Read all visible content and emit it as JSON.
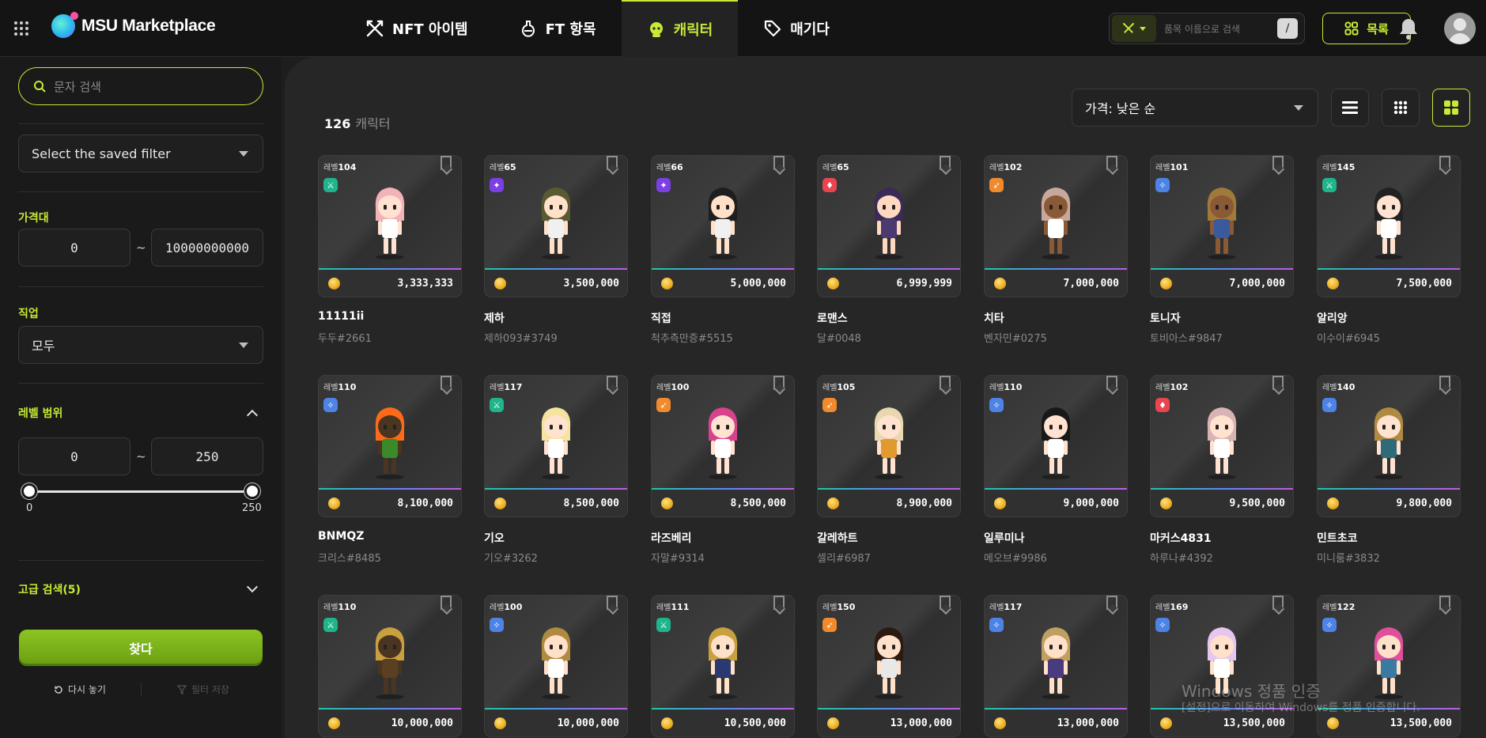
{
  "header": {
    "logo_text": "MSU Marketplace",
    "nav": [
      {
        "label": "NFT 아이템",
        "icon": "crossed-swords-icon"
      },
      {
        "label": "FT 항목",
        "icon": "potion-icon"
      },
      {
        "label": "캐릭터",
        "icon": "character-face-icon",
        "active": true
      },
      {
        "label": "매기다",
        "icon": "tag-icon"
      }
    ],
    "search_placeholder": "품목 이름으로 검색",
    "list_button": "목록"
  },
  "sidebar": {
    "search_placeholder": "문자 검색",
    "saved_filter": "Select the saved filter",
    "price_label": "가격대",
    "price_min": "0",
    "price_max": "10000000000",
    "job_label": "직업",
    "job_value": "모두",
    "level_label": "레벨 범위",
    "level_min": "0",
    "level_max": "250",
    "slider_min_label": "0",
    "slider_max_label": "250",
    "slider_low": 0,
    "slider_high": 250,
    "advanced_label": "고급 검색(5)",
    "find_button": "찾다",
    "reset_label": "다시 놓기",
    "save_filter_label": "필터 저장"
  },
  "main": {
    "count_number": "126",
    "count_label": "캐릭터",
    "sort_value": "가격: 낮은 순"
  },
  "colors": {
    "accent": "#c6ea35"
  },
  "level_prefix": "레벨",
  "cards": [
    {
      "level": "104",
      "job_color": "#1fb58c",
      "job_icon": "sword-icon",
      "price": "3,333,333",
      "name": "11111ii",
      "id": "두두#2661"
    },
    {
      "level": "65",
      "job_color": "#7b3fe4",
      "job_icon": "sparkle-icon",
      "price": "3,500,000",
      "name": "제하",
      "id": "제하093#3749"
    },
    {
      "level": "66",
      "job_color": "#7b3fe4",
      "job_icon": "sparkle-icon",
      "price": "5,000,000",
      "name": "직접",
      "id": "척추측만증#5515"
    },
    {
      "level": "65",
      "job_color": "#e8454f",
      "job_icon": "flame-icon",
      "price": "6,999,999",
      "name": "로맨스",
      "id": "달#0048"
    },
    {
      "level": "102",
      "job_color": "#f08a2c",
      "job_icon": "bow-icon",
      "price": "7,000,000",
      "name": "치타",
      "id": "벤자민#0275"
    },
    {
      "level": "101",
      "job_color": "#4d83e6",
      "job_icon": "wand-icon",
      "price": "7,000,000",
      "name": "토니자",
      "id": "토비아스#9847"
    },
    {
      "level": "145",
      "job_color": "#1fb58c",
      "job_icon": "sword-icon",
      "price": "7,500,000",
      "name": "알리앙",
      "id": "이수이#6945"
    },
    {
      "level": "110",
      "job_color": "#4d83e6",
      "job_icon": "wand-icon",
      "price": "8,100,000",
      "name": "BNMQZ",
      "id": "크리스#8485"
    },
    {
      "level": "117",
      "job_color": "#1fb58c",
      "job_icon": "sword-icon",
      "price": "8,500,000",
      "name": "기오",
      "id": "기오#3262"
    },
    {
      "level": "100",
      "job_color": "#f08a2c",
      "job_icon": "bow-icon",
      "price": "8,500,000",
      "name": "라즈베리",
      "id": "자말#9314"
    },
    {
      "level": "105",
      "job_color": "#f08a2c",
      "job_icon": "bow-icon",
      "price": "8,900,000",
      "name": "갈레하트",
      "id": "셀리#6987"
    },
    {
      "level": "110",
      "job_color": "#4d83e6",
      "job_icon": "wand-icon",
      "price": "9,000,000",
      "name": "일루미나",
      "id": "메오브#9986"
    },
    {
      "level": "102",
      "job_color": "#e8454f",
      "job_icon": "flame-icon",
      "price": "9,500,000",
      "name": "마커스4831",
      "id": "하루나#4392"
    },
    {
      "level": "140",
      "job_color": "#4d83e6",
      "job_icon": "wand-icon",
      "price": "9,800,000",
      "name": "민트초코",
      "id": "미니룸#3832"
    },
    {
      "level": "110",
      "job_color": "#1fb58c",
      "job_icon": "sword-icon",
      "price": "10,000,000",
      "name": "",
      "id": ""
    },
    {
      "level": "100",
      "job_color": "#4d83e6",
      "job_icon": "wand-icon",
      "price": "10,000,000",
      "name": "",
      "id": ""
    },
    {
      "level": "111",
      "job_color": "#1fb58c",
      "job_icon": "sword-icon",
      "price": "10,500,000",
      "name": "",
      "id": ""
    },
    {
      "level": "150",
      "job_color": "#f08a2c",
      "job_icon": "bow-icon",
      "price": "13,000,000",
      "name": "",
      "id": ""
    },
    {
      "level": "117",
      "job_color": "#4d83e6",
      "job_icon": "wand-icon",
      "price": "13,000,000",
      "name": "",
      "id": ""
    },
    {
      "level": "169",
      "job_color": "#4d83e6",
      "job_icon": "wand-icon",
      "price": "13,500,000",
      "name": "",
      "id": ""
    },
    {
      "level": "122",
      "job_color": "#4d83e6",
      "job_icon": "wand-icon",
      "price": "13,500,000",
      "name": "",
      "id": ""
    }
  ],
  "watermark": {
    "line1": "Windows 정품 인증",
    "line2": "[설정]으로 이동하여 Windows를 정품 인증합니다."
  }
}
